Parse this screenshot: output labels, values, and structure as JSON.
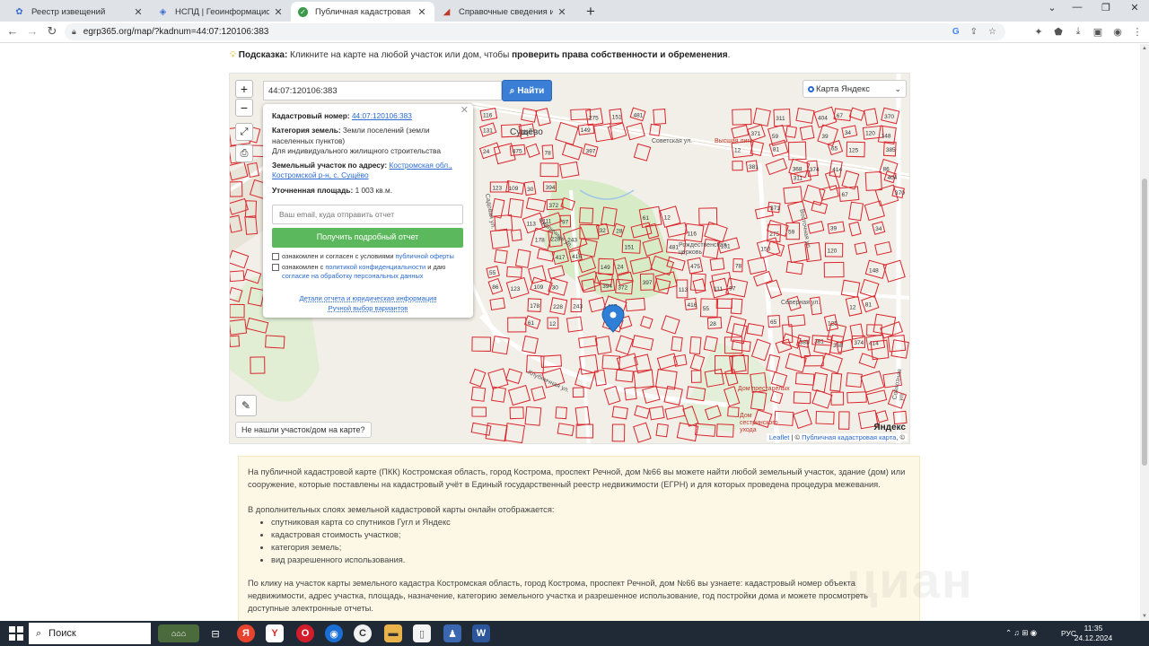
{
  "browser": {
    "tabs": [
      {
        "title": "Реестр извещений",
        "icon": "globe-icon",
        "active": false
      },
      {
        "title": "НСПД | Геоинформационный портал",
        "icon": "globe-icon",
        "active": false
      },
      {
        "title": "Публичная кадастровая карта ПКК",
        "icon": "check-circle-icon",
        "active": true
      },
      {
        "title": "Справочные сведения из ФГИС ЕГРН",
        "icon": "chart-icon",
        "active": false
      }
    ],
    "url": "egrp365.org/map/?kadnum=44:07:120106:383"
  },
  "hint": {
    "label": "Подсказка:",
    "text": " Кликните на карте на любой участок или дом, чтобы ",
    "bold": "проверить права собственности и обременения",
    "end": "."
  },
  "map": {
    "search_value": "44:07:120106:383",
    "search_button": "Найти",
    "layer_select": "Карта Яндекс",
    "zoom_in": "+",
    "zoom_out": "−",
    "not_found_button": "Не нашли участок/дом на карте?",
    "attribution_leaflet": "Leaflet",
    "attribution_sep": " | © ",
    "attribution_pkk": "Публичная кадастровая карта",
    "attribution_end": ", ©",
    "yandex_logo": "Яндекс",
    "place_names": [
      "Сущёво",
      "Рождественская церковь",
      "Советская ул.",
      "Высшая лига",
      "Кирпичная ул.",
      "Восточная ул.",
      "Северная ул.",
      "Садовая ул.",
      "Клубничная ул.",
      "Совхозная ул.",
      "Дом престарелых",
      "Дом сестринского ухода"
    ],
    "parcel_numbers": [
      "116",
      "275",
      "151",
      "481",
      "131",
      "150",
      "149",
      "24",
      "475",
      "78",
      "397",
      "311",
      "404",
      "67",
      "370",
      "371",
      "59",
      "39",
      "34",
      "120",
      "148",
      "12",
      "81",
      "65",
      "125",
      "385",
      "381",
      "368",
      "374",
      "414",
      "86",
      "123",
      "109",
      "30",
      "394",
      "372",
      "113",
      "111",
      "97",
      "178",
      "228",
      "243",
      "417",
      "416",
      "55",
      "61",
      "12",
      "32",
      "28"
    ]
  },
  "popup": {
    "cadnum_label": "Кадастровый номер:",
    "cadnum": "44:07:120106:383",
    "category_label": "Категория земель:",
    "category_value": "Земли поселений (земли населенных пунктов)",
    "use": "Для индивидуального жилищного строительства",
    "address_label": "Земельный участок по адресу:",
    "address_value": "Костромская обл., Костромской р-н, с. Сущёво",
    "area_label": "Уточненная площадь:",
    "area_value": "1 003 кв.м.",
    "email_placeholder": "Ваш email, куда отправить отчет",
    "get_report": "Получить подробный отчет",
    "agree1_pre": "ознакомлен и согласен с условиями ",
    "agree1_link": "публичной оферты",
    "agree2_pre": "ознакомлен с ",
    "agree2_link1": "политикой конфиденциальности",
    "agree2_mid": " и даю ",
    "agree2_link2": "согласие на обработку персональных данных",
    "details_link": "Детали отчета и юридическая информация",
    "manual_link": "Ручной выбор вариантов"
  },
  "info": {
    "p1": "На публичной кадастровой карте (ПКК) Костромская область, город Кострома, проспект Речной, дом №66 вы можете найти любой земельный участок, здание (дом) или сооружение, которые поставлены на кадастровый учёт в Единый государственный реестр недвижимости (ЕГРН) и для которых проведена процедура межевания.",
    "p2": "В дополнительных слоях земельной кадастровой карты онлайн отображается:",
    "list": [
      "спутниковая карта со спутников Гугл и Яндекс",
      "кадастровая стоимость участков;",
      "категория земель;",
      "вид разрешенного использования."
    ],
    "p3": "По клику на участок карты земельного кадастра Костромская область, город Кострома, проспект Речной, дом №66 вы узнаете: кадастровый номер объекта недвижимости, адрес участка, площадь, назначение, категорию земельного участка и разрешенное использование, год постройки дома и можете просмотреть доступные электронные отчеты.",
    "watermark": "циан"
  },
  "taskbar": {
    "search": "Поиск",
    "lang": "РУС",
    "time": "11:35",
    "date": "24.12.2024"
  },
  "colors": {
    "parcel_line": "#d9262c",
    "search_button": "#3a7fd5",
    "report_button": "#5cb85c",
    "link": "#2a6ad2"
  }
}
